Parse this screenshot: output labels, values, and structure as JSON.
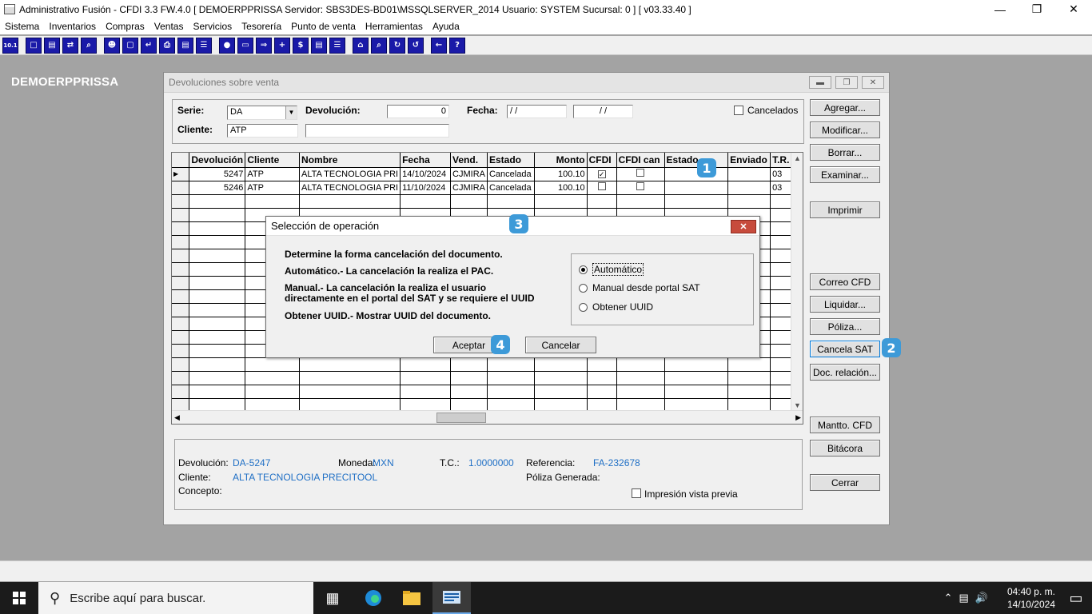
{
  "app": {
    "title": "Administrativo Fusión - CFDI 3.3 FW.4.0 [ DEMOERPPRISSA   Servidor: SBS3DES-BD01\\MSSQLSERVER_2014    Usuario: SYSTEM     Sucursal: 0 ] [ v03.33.40 ]",
    "company": "DEMOERPPRISSA"
  },
  "menu": [
    "Sistema",
    "Inventarios",
    "Compras",
    "Ventas",
    "Servicios",
    "Tesorería",
    "Punto de venta",
    "Herramientas",
    "Ayuda"
  ],
  "toolbar_icons": [
    "10.1",
    "copy",
    "clip",
    "swap",
    "zoom",
    "user",
    "doc",
    "back",
    "print",
    "page",
    "list",
    "ids",
    "card",
    "out",
    "plus",
    "$",
    "book",
    "memo",
    "home",
    "find",
    "refresh",
    "undo",
    "arrow-left",
    "?"
  ],
  "child": {
    "title": "Devoluciones sobre venta",
    "labels": {
      "serie": "Serie:",
      "devolucion": "Devolución:",
      "fecha": "Fecha:",
      "cliente": "Cliente:",
      "cancelados": "Cancelados"
    },
    "fields": {
      "serie": "DA",
      "devolucion": "0",
      "fecha1": " / /",
      "fecha2": " / /",
      "cliente": "ATP",
      "cliente_nombre": ""
    },
    "grid": {
      "headers": [
        "Devolución",
        "Cliente",
        "Nombre",
        "Fecha",
        "Vend.",
        "Estado",
        "Monto",
        "CFDI",
        "CFDI can",
        "Estado",
        "Enviado",
        "T.R."
      ],
      "rows": [
        {
          "devolucion": "5247",
          "cliente": "ATP",
          "nombre": "ALTA TECNOLOGIA PRI",
          "fecha": "14/10/2024",
          "vend": "CJMIRA",
          "estado": "Cancelada",
          "monto": "100.10",
          "cfdi": true,
          "cfdi_can": false,
          "estado2": "",
          "enviado": "",
          "tr": "03"
        },
        {
          "devolucion": "5246",
          "cliente": "ATP",
          "nombre": "ALTA TECNOLOGIA PRI",
          "fecha": "11/10/2024",
          "vend": "CJMIRA",
          "estado": "Cancelada",
          "monto": "100.10",
          "cfdi": false,
          "cfdi_can": false,
          "estado2": "",
          "enviado": "",
          "tr": "03"
        }
      ],
      "empty_rows": 16
    },
    "buttons": {
      "agregar": "Agregar...",
      "modificar": "Modificar...",
      "borrar": "Borrar...",
      "examinar": "Examinar...",
      "imprimir": "Imprimir",
      "correo": "Correo CFD",
      "liquidar": "Liquidar...",
      "poliza": "Póliza...",
      "cancela_sat": "Cancela SAT",
      "doc_relacion": "Doc. relación...",
      "mantto": "Mantto. CFD",
      "bitacora": "Bitácora",
      "cerrar": "Cerrar"
    },
    "info": {
      "devolucion_label": "Devolución:",
      "devolucion_value": "DA-5247",
      "moneda_label": "Moneda:",
      "moneda_value": "MXN",
      "tc_label": "T.C.:",
      "tc_value": "1.0000000",
      "referencia_label": "Referencia:",
      "referencia_value": "FA-232678",
      "cliente_label": "Cliente:",
      "cliente_value": "ALTA TECNOLOGIA PRECITOOL",
      "poliza_label": "Póliza Generada:",
      "concepto_label": "Concepto:",
      "vista_previa": "Impresión vista previa"
    }
  },
  "dialog": {
    "title": "Selección de operación",
    "lines": [
      "Determine la forma cancelación del documento.",
      "Automático.- La cancelación la realiza el PAC.",
      "Manual.- La cancelación la realiza el usuario",
      "directamente en el portal del SAT y se requiere el UUID",
      "Obtener UUID.- Mostrar UUID del documento."
    ],
    "options": [
      "Automático",
      "Manual desde portal SAT",
      "Obtener UUID"
    ],
    "selected": "Automático",
    "accept": "Aceptar",
    "cancel": "Cancelar",
    "close_glyph": "✕"
  },
  "badges": [
    "1",
    "2",
    "3",
    "4"
  ],
  "taskbar": {
    "search_placeholder": "Escribe aquí para buscar.",
    "time": "04:40 p. m.",
    "date": "14/10/2024"
  },
  "colors": {
    "accent_badge": "#3d9ad8",
    "info_value": "#1f6fc5",
    "desktop": "#a3a3a3"
  }
}
